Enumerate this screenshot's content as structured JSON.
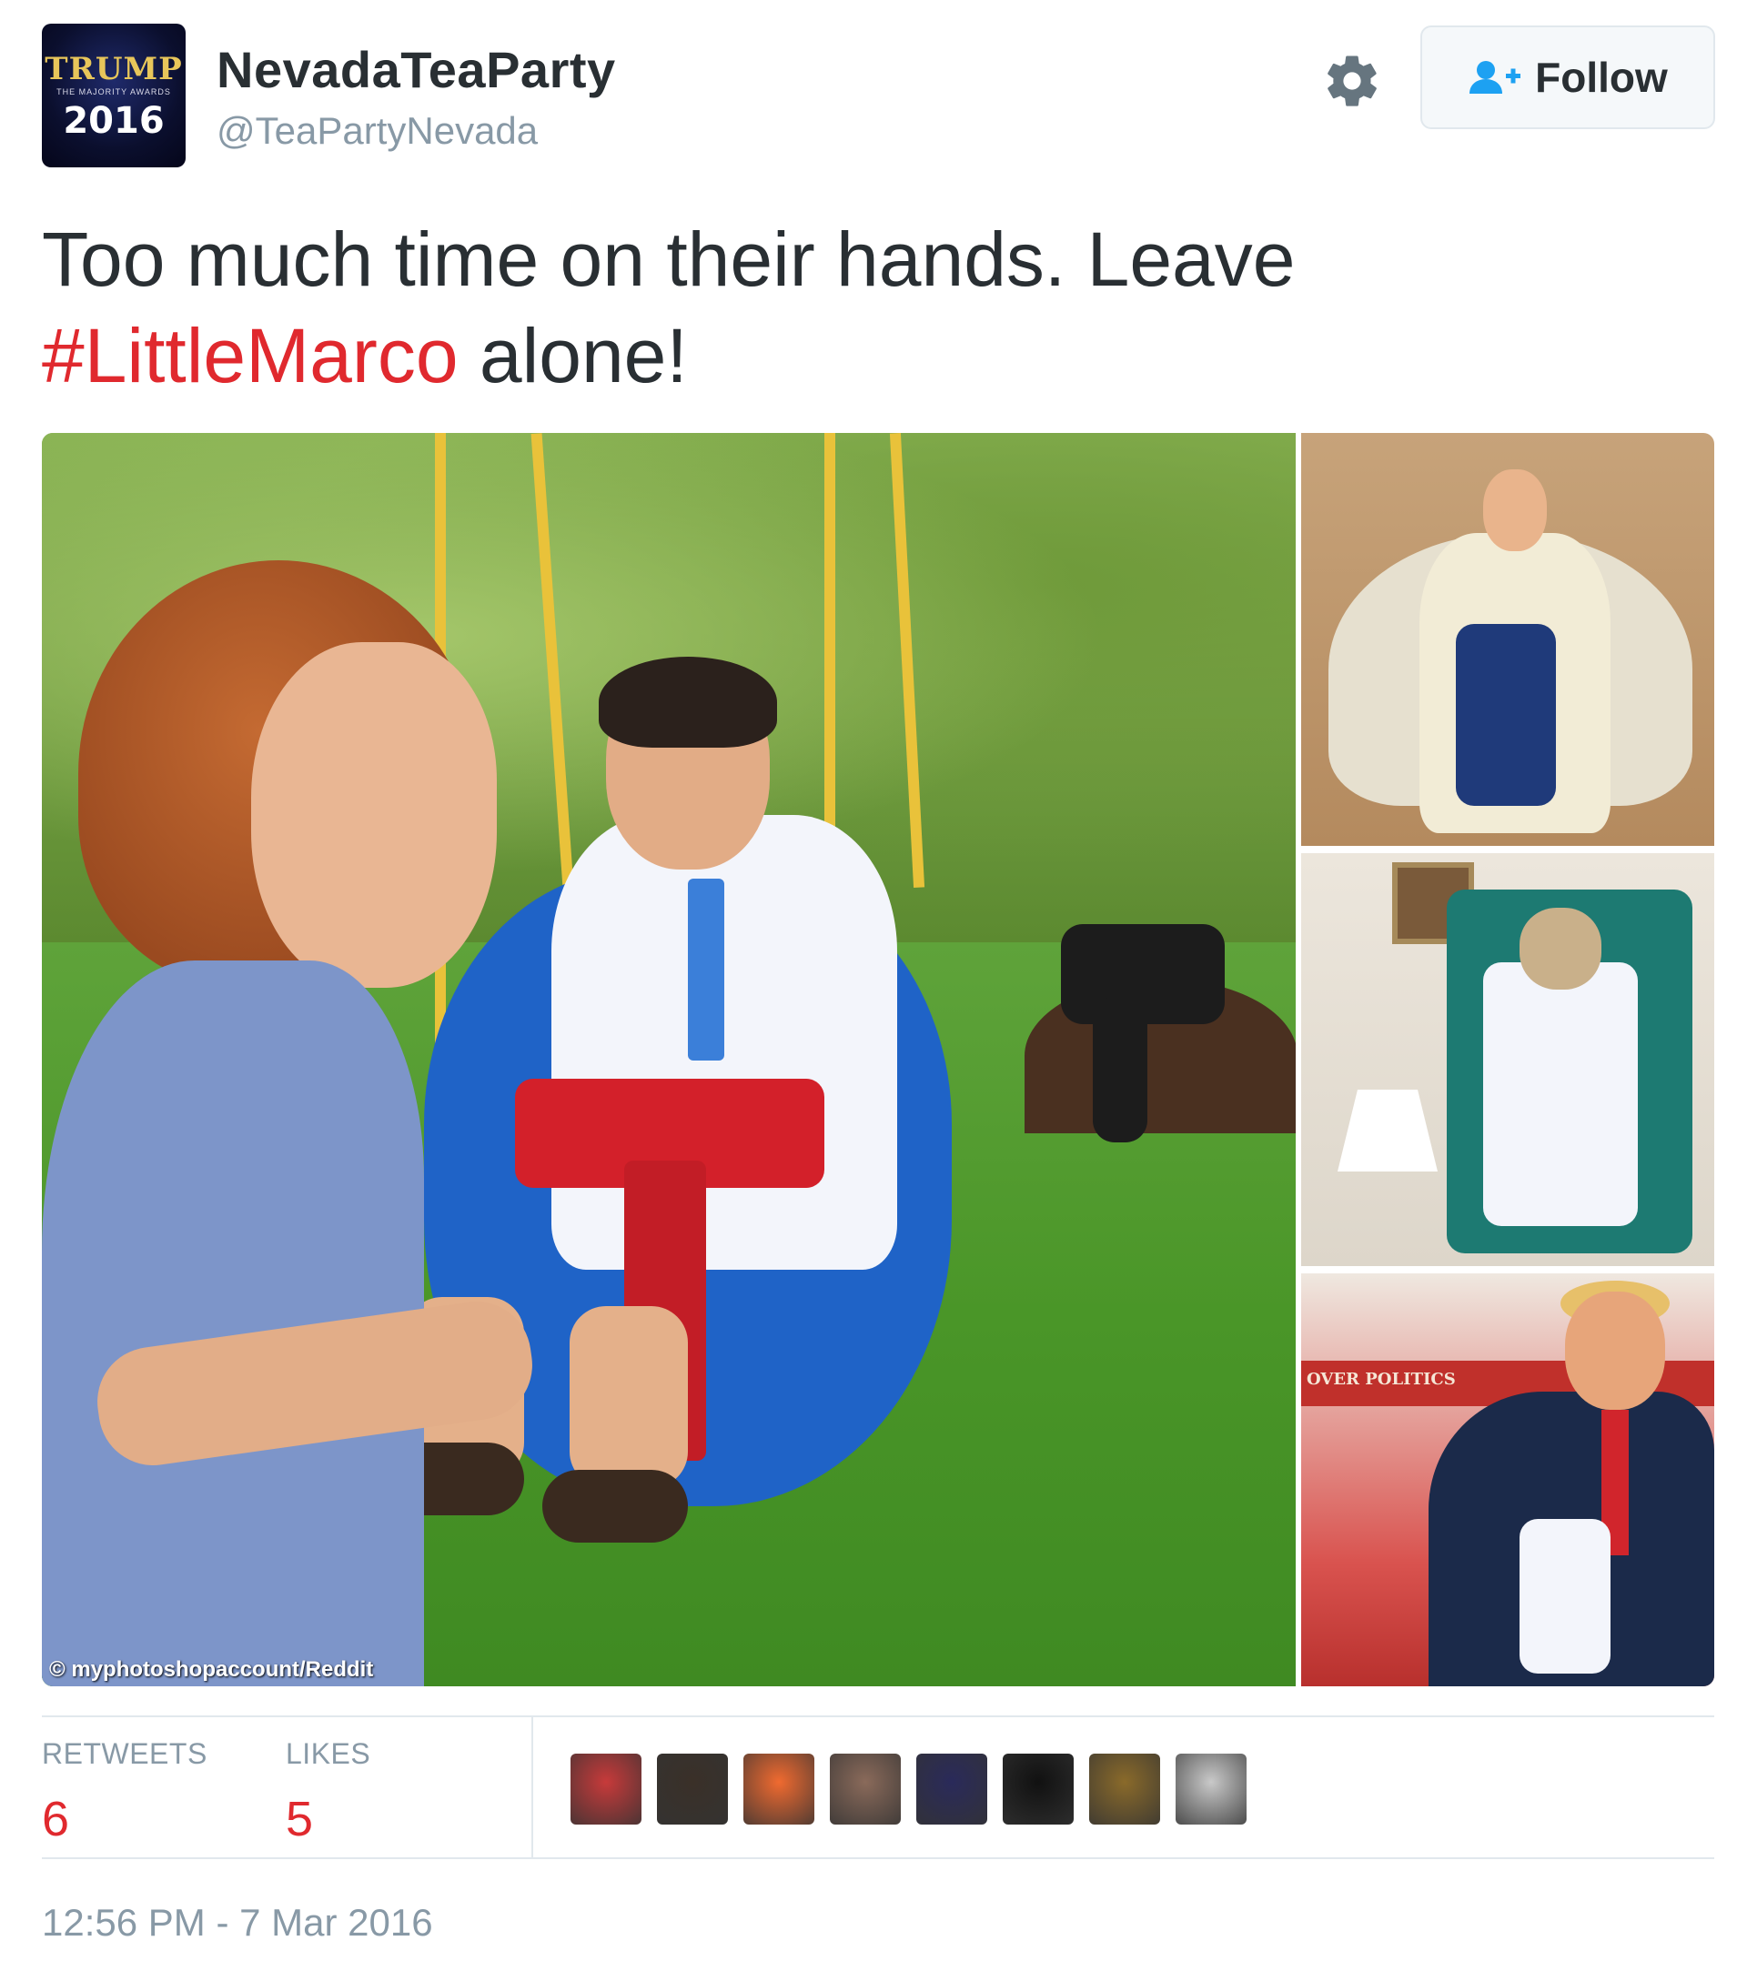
{
  "user": {
    "display_name": "NevadaTeaParty",
    "handle": "@TeaPartyNevada",
    "avatar": {
      "title_text": "TRUMP",
      "subtitle_text": "THE MAJORITY AWARDS",
      "year_text": "2016"
    }
  },
  "actions": {
    "settings_icon": "gear-icon",
    "follow_label": "Follow",
    "follow_icon": "add-user-icon"
  },
  "tweet": {
    "text_before": "Too much time on their hands. Leave ",
    "hashtag": "#LittleMarco",
    "text_after": " alone!",
    "hashtag_color": "#e0292e"
  },
  "media": {
    "main_credit": "© myphotoshopaccount/Reddit",
    "side_banner_text": "OVER POLITICS"
  },
  "stats": {
    "retweets_label": "RETWEETS",
    "retweets_value": "6",
    "likes_label": "LIKES",
    "likes_value": "5",
    "value_color": "#e0292e"
  },
  "likers": [
    {
      "name": "liker-avatar-1",
      "color": "#c73a3a"
    },
    {
      "name": "liker-avatar-2",
      "color": "#3a3028"
    },
    {
      "name": "liker-avatar-3",
      "color": "#f06a30"
    },
    {
      "name": "liker-avatar-4",
      "color": "#8a6a5a"
    },
    {
      "name": "liker-avatar-5",
      "color": "#2a2a5a"
    },
    {
      "name": "liker-avatar-6",
      "color": "#111111"
    },
    {
      "name": "liker-avatar-7",
      "color": "#8a6a2a"
    },
    {
      "name": "liker-avatar-8",
      "color": "#c9c9c9"
    }
  ],
  "timestamp": "12:56 PM - 7 Mar 2016"
}
